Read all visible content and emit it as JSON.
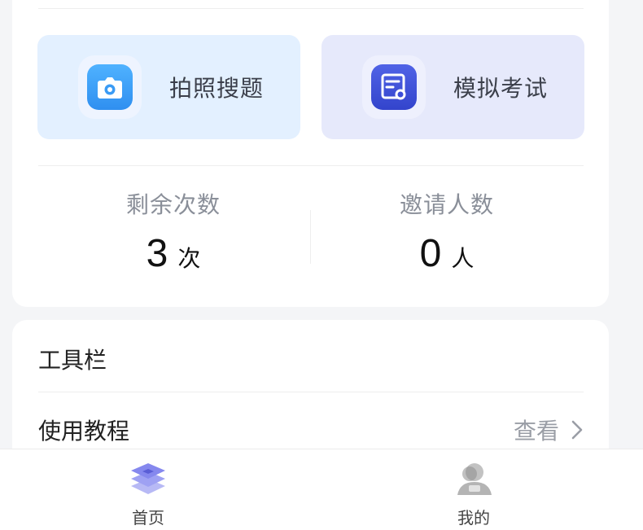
{
  "quick_actions": [
    {
      "label": "拍照搜题",
      "icon": "camera-icon"
    },
    {
      "label": "模拟考试",
      "icon": "exam-paper-icon"
    }
  ],
  "stats": [
    {
      "title": "剩余次数",
      "value": "3",
      "unit": "次"
    },
    {
      "title": "邀请人数",
      "value": "0",
      "unit": "人"
    }
  ],
  "tools": {
    "title": "工具栏",
    "items": [
      {
        "label": "使用教程",
        "action": "查看",
        "icon": "chevron-right-icon"
      }
    ]
  },
  "tabbar": {
    "tabs": [
      {
        "label": "首页",
        "icon": "layers-icon",
        "active": true
      },
      {
        "label": "我的",
        "icon": "user-icon",
        "active": false
      }
    ]
  },
  "colors": {
    "photo_bg": "#e3f0ff",
    "exam_bg": "#e6e9fb",
    "camera_blue": "#3a9bf5",
    "exam_indigo": "#3b4ed8",
    "home_purple": "#8c8ff2"
  }
}
